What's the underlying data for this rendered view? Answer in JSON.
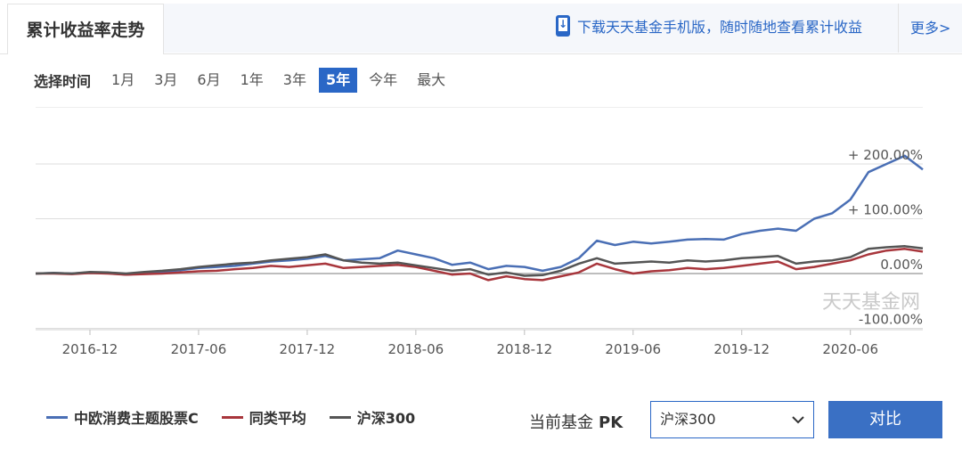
{
  "header": {
    "active_tab": "累计收益率走势",
    "download_text": "下载天天基金手机版，随时随地查看累计收益",
    "more_text": "更多>"
  },
  "time_selector": {
    "label": "选择时间",
    "options": [
      "1月",
      "3月",
      "6月",
      "1年",
      "3年",
      "5年",
      "今年",
      "最大"
    ],
    "selected": "5年"
  },
  "chart_data": {
    "type": "line",
    "watermark": "天天基金网",
    "x_tick_labels": [
      "2016-12",
      "2017-06",
      "2017-12",
      "2018-06",
      "2018-12",
      "2019-06",
      "2019-12",
      "2020-06"
    ],
    "y_tick_labels": [
      "+ 200.00%",
      "+ 100.00%",
      "0.00%",
      "-100.00%"
    ],
    "ylim": [
      -100,
      200
    ],
    "x_range": [
      "2016-09",
      "2020-10"
    ],
    "grid": true,
    "series": [
      {
        "name": "中欧消费主题股票C",
        "color": "#4a6fb5",
        "points": [
          [
            "2016-09",
            0
          ],
          [
            "2016-10",
            1
          ],
          [
            "2016-11",
            0
          ],
          [
            "2016-12",
            2
          ],
          [
            "2017-01",
            1
          ],
          [
            "2017-02",
            -2
          ],
          [
            "2017-03",
            0
          ],
          [
            "2017-04",
            3
          ],
          [
            "2017-05",
            6
          ],
          [
            "2017-06",
            10
          ],
          [
            "2017-07",
            12
          ],
          [
            "2017-08",
            14
          ],
          [
            "2017-09",
            18
          ],
          [
            "2017-10",
            22
          ],
          [
            "2017-11",
            24
          ],
          [
            "2017-12",
            27
          ],
          [
            "2018-01",
            32
          ],
          [
            "2018-02",
            24
          ],
          [
            "2018-03",
            26
          ],
          [
            "2018-04",
            28
          ],
          [
            "2018-05",
            42
          ],
          [
            "2018-06",
            35
          ],
          [
            "2018-07",
            28
          ],
          [
            "2018-08",
            16
          ],
          [
            "2018-09",
            20
          ],
          [
            "2018-10",
            8
          ],
          [
            "2018-11",
            14
          ],
          [
            "2018-12",
            12
          ],
          [
            "2019-01",
            5
          ],
          [
            "2019-02",
            12
          ],
          [
            "2019-03",
            28
          ],
          [
            "2019-04",
            60
          ],
          [
            "2019-05",
            52
          ],
          [
            "2019-06",
            58
          ],
          [
            "2019-07",
            55
          ],
          [
            "2019-08",
            58
          ],
          [
            "2019-09",
            62
          ],
          [
            "2019-10",
            63
          ],
          [
            "2019-11",
            62
          ],
          [
            "2019-12",
            72
          ],
          [
            "2020-01",
            78
          ],
          [
            "2020-02",
            82
          ],
          [
            "2020-03",
            78
          ],
          [
            "2020-04",
            100
          ],
          [
            "2020-05",
            110
          ],
          [
            "2020-06",
            135
          ],
          [
            "2020-07",
            185
          ],
          [
            "2020-08",
            200
          ],
          [
            "2020-09",
            215
          ],
          [
            "2020-10",
            190
          ]
        ]
      },
      {
        "name": "同类平均",
        "color": "#a8363c",
        "points": [
          [
            "2016-09",
            0
          ],
          [
            "2016-10",
            0
          ],
          [
            "2016-11",
            -1
          ],
          [
            "2016-12",
            1
          ],
          [
            "2017-01",
            0
          ],
          [
            "2017-02",
            -2
          ],
          [
            "2017-03",
            -1
          ],
          [
            "2017-04",
            0
          ],
          [
            "2017-05",
            2
          ],
          [
            "2017-06",
            4
          ],
          [
            "2017-07",
            5
          ],
          [
            "2017-08",
            8
          ],
          [
            "2017-09",
            10
          ],
          [
            "2017-10",
            14
          ],
          [
            "2017-11",
            12
          ],
          [
            "2017-12",
            15
          ],
          [
            "2018-01",
            18
          ],
          [
            "2018-02",
            10
          ],
          [
            "2018-03",
            12
          ],
          [
            "2018-04",
            14
          ],
          [
            "2018-05",
            16
          ],
          [
            "2018-06",
            12
          ],
          [
            "2018-07",
            5
          ],
          [
            "2018-08",
            -2
          ],
          [
            "2018-09",
            0
          ],
          [
            "2018-10",
            -12
          ],
          [
            "2018-11",
            -5
          ],
          [
            "2018-12",
            -10
          ],
          [
            "2019-01",
            -12
          ],
          [
            "2019-02",
            -5
          ],
          [
            "2019-03",
            2
          ],
          [
            "2019-04",
            18
          ],
          [
            "2019-05",
            8
          ],
          [
            "2019-06",
            0
          ],
          [
            "2019-07",
            4
          ],
          [
            "2019-08",
            6
          ],
          [
            "2019-09",
            10
          ],
          [
            "2019-10",
            8
          ],
          [
            "2019-11",
            10
          ],
          [
            "2019-12",
            14
          ],
          [
            "2020-01",
            18
          ],
          [
            "2020-02",
            22
          ],
          [
            "2020-03",
            8
          ],
          [
            "2020-04",
            12
          ],
          [
            "2020-05",
            18
          ],
          [
            "2020-06",
            24
          ],
          [
            "2020-07",
            35
          ],
          [
            "2020-08",
            42
          ],
          [
            "2020-09",
            45
          ],
          [
            "2020-10",
            40
          ]
        ]
      },
      {
        "name": "沪深300",
        "color": "#555555",
        "points": [
          [
            "2016-09",
            0
          ],
          [
            "2016-10",
            1
          ],
          [
            "2016-11",
            0
          ],
          [
            "2016-12",
            3
          ],
          [
            "2017-01",
            2
          ],
          [
            "2017-02",
            0
          ],
          [
            "2017-03",
            3
          ],
          [
            "2017-04",
            5
          ],
          [
            "2017-05",
            8
          ],
          [
            "2017-06",
            12
          ],
          [
            "2017-07",
            15
          ],
          [
            "2017-08",
            18
          ],
          [
            "2017-09",
            20
          ],
          [
            "2017-10",
            24
          ],
          [
            "2017-11",
            27
          ],
          [
            "2017-12",
            30
          ],
          [
            "2018-01",
            35
          ],
          [
            "2018-02",
            24
          ],
          [
            "2018-03",
            20
          ],
          [
            "2018-04",
            18
          ],
          [
            "2018-05",
            20
          ],
          [
            "2018-06",
            15
          ],
          [
            "2018-07",
            10
          ],
          [
            "2018-08",
            5
          ],
          [
            "2018-09",
            8
          ],
          [
            "2018-10",
            -2
          ],
          [
            "2018-11",
            2
          ],
          [
            "2018-12",
            -4
          ],
          [
            "2019-01",
            -3
          ],
          [
            "2019-02",
            5
          ],
          [
            "2019-03",
            18
          ],
          [
            "2019-04",
            28
          ],
          [
            "2019-05",
            18
          ],
          [
            "2019-06",
            20
          ],
          [
            "2019-07",
            22
          ],
          [
            "2019-08",
            20
          ],
          [
            "2019-09",
            24
          ],
          [
            "2019-10",
            22
          ],
          [
            "2019-11",
            24
          ],
          [
            "2019-12",
            28
          ],
          [
            "2020-01",
            30
          ],
          [
            "2020-02",
            32
          ],
          [
            "2020-03",
            18
          ],
          [
            "2020-04",
            22
          ],
          [
            "2020-05",
            24
          ],
          [
            "2020-06",
            30
          ],
          [
            "2020-07",
            45
          ],
          [
            "2020-08",
            48
          ],
          [
            "2020-09",
            50
          ],
          [
            "2020-10",
            46
          ]
        ]
      }
    ]
  },
  "pk": {
    "label": "当前基金",
    "pk_text": "PK",
    "selected": "沪深300",
    "compare_button": "对比"
  }
}
